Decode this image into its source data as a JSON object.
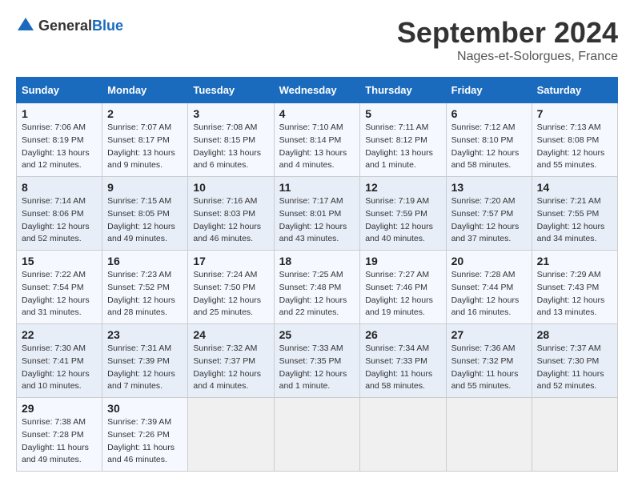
{
  "logo": {
    "text_general": "General",
    "text_blue": "Blue"
  },
  "header": {
    "month_year": "September 2024",
    "location": "Nages-et-Solorgues, France"
  },
  "weekdays": [
    "Sunday",
    "Monday",
    "Tuesday",
    "Wednesday",
    "Thursday",
    "Friday",
    "Saturday"
  ],
  "weeks": [
    [
      {
        "day": "1",
        "sunrise": "Sunrise: 7:06 AM",
        "sunset": "Sunset: 8:19 PM",
        "daylight": "Daylight: 13 hours and 12 minutes."
      },
      {
        "day": "2",
        "sunrise": "Sunrise: 7:07 AM",
        "sunset": "Sunset: 8:17 PM",
        "daylight": "Daylight: 13 hours and 9 minutes."
      },
      {
        "day": "3",
        "sunrise": "Sunrise: 7:08 AM",
        "sunset": "Sunset: 8:15 PM",
        "daylight": "Daylight: 13 hours and 6 minutes."
      },
      {
        "day": "4",
        "sunrise": "Sunrise: 7:10 AM",
        "sunset": "Sunset: 8:14 PM",
        "daylight": "Daylight: 13 hours and 4 minutes."
      },
      {
        "day": "5",
        "sunrise": "Sunrise: 7:11 AM",
        "sunset": "Sunset: 8:12 PM",
        "daylight": "Daylight: 13 hours and 1 minute."
      },
      {
        "day": "6",
        "sunrise": "Sunrise: 7:12 AM",
        "sunset": "Sunset: 8:10 PM",
        "daylight": "Daylight: 12 hours and 58 minutes."
      },
      {
        "day": "7",
        "sunrise": "Sunrise: 7:13 AM",
        "sunset": "Sunset: 8:08 PM",
        "daylight": "Daylight: 12 hours and 55 minutes."
      }
    ],
    [
      {
        "day": "8",
        "sunrise": "Sunrise: 7:14 AM",
        "sunset": "Sunset: 8:06 PM",
        "daylight": "Daylight: 12 hours and 52 minutes."
      },
      {
        "day": "9",
        "sunrise": "Sunrise: 7:15 AM",
        "sunset": "Sunset: 8:05 PM",
        "daylight": "Daylight: 12 hours and 49 minutes."
      },
      {
        "day": "10",
        "sunrise": "Sunrise: 7:16 AM",
        "sunset": "Sunset: 8:03 PM",
        "daylight": "Daylight: 12 hours and 46 minutes."
      },
      {
        "day": "11",
        "sunrise": "Sunrise: 7:17 AM",
        "sunset": "Sunset: 8:01 PM",
        "daylight": "Daylight: 12 hours and 43 minutes."
      },
      {
        "day": "12",
        "sunrise": "Sunrise: 7:19 AM",
        "sunset": "Sunset: 7:59 PM",
        "daylight": "Daylight: 12 hours and 40 minutes."
      },
      {
        "day": "13",
        "sunrise": "Sunrise: 7:20 AM",
        "sunset": "Sunset: 7:57 PM",
        "daylight": "Daylight: 12 hours and 37 minutes."
      },
      {
        "day": "14",
        "sunrise": "Sunrise: 7:21 AM",
        "sunset": "Sunset: 7:55 PM",
        "daylight": "Daylight: 12 hours and 34 minutes."
      }
    ],
    [
      {
        "day": "15",
        "sunrise": "Sunrise: 7:22 AM",
        "sunset": "Sunset: 7:54 PM",
        "daylight": "Daylight: 12 hours and 31 minutes."
      },
      {
        "day": "16",
        "sunrise": "Sunrise: 7:23 AM",
        "sunset": "Sunset: 7:52 PM",
        "daylight": "Daylight: 12 hours and 28 minutes."
      },
      {
        "day": "17",
        "sunrise": "Sunrise: 7:24 AM",
        "sunset": "Sunset: 7:50 PM",
        "daylight": "Daylight: 12 hours and 25 minutes."
      },
      {
        "day": "18",
        "sunrise": "Sunrise: 7:25 AM",
        "sunset": "Sunset: 7:48 PM",
        "daylight": "Daylight: 12 hours and 22 minutes."
      },
      {
        "day": "19",
        "sunrise": "Sunrise: 7:27 AM",
        "sunset": "Sunset: 7:46 PM",
        "daylight": "Daylight: 12 hours and 19 minutes."
      },
      {
        "day": "20",
        "sunrise": "Sunrise: 7:28 AM",
        "sunset": "Sunset: 7:44 PM",
        "daylight": "Daylight: 12 hours and 16 minutes."
      },
      {
        "day": "21",
        "sunrise": "Sunrise: 7:29 AM",
        "sunset": "Sunset: 7:43 PM",
        "daylight": "Daylight: 12 hours and 13 minutes."
      }
    ],
    [
      {
        "day": "22",
        "sunrise": "Sunrise: 7:30 AM",
        "sunset": "Sunset: 7:41 PM",
        "daylight": "Daylight: 12 hours and 10 minutes."
      },
      {
        "day": "23",
        "sunrise": "Sunrise: 7:31 AM",
        "sunset": "Sunset: 7:39 PM",
        "daylight": "Daylight: 12 hours and 7 minutes."
      },
      {
        "day": "24",
        "sunrise": "Sunrise: 7:32 AM",
        "sunset": "Sunset: 7:37 PM",
        "daylight": "Daylight: 12 hours and 4 minutes."
      },
      {
        "day": "25",
        "sunrise": "Sunrise: 7:33 AM",
        "sunset": "Sunset: 7:35 PM",
        "daylight": "Daylight: 12 hours and 1 minute."
      },
      {
        "day": "26",
        "sunrise": "Sunrise: 7:34 AM",
        "sunset": "Sunset: 7:33 PM",
        "daylight": "Daylight: 11 hours and 58 minutes."
      },
      {
        "day": "27",
        "sunrise": "Sunrise: 7:36 AM",
        "sunset": "Sunset: 7:32 PM",
        "daylight": "Daylight: 11 hours and 55 minutes."
      },
      {
        "day": "28",
        "sunrise": "Sunrise: 7:37 AM",
        "sunset": "Sunset: 7:30 PM",
        "daylight": "Daylight: 11 hours and 52 minutes."
      }
    ],
    [
      {
        "day": "29",
        "sunrise": "Sunrise: 7:38 AM",
        "sunset": "Sunset: 7:28 PM",
        "daylight": "Daylight: 11 hours and 49 minutes."
      },
      {
        "day": "30",
        "sunrise": "Sunrise: 7:39 AM",
        "sunset": "Sunset: 7:26 PM",
        "daylight": "Daylight: 11 hours and 46 minutes."
      },
      null,
      null,
      null,
      null,
      null
    ]
  ]
}
